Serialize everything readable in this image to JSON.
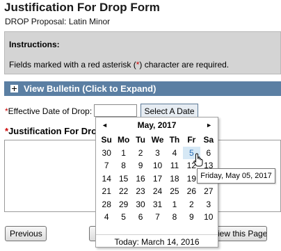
{
  "page": {
    "title": "Justification For Drop Form",
    "subtitle": "DROP Proposal: Latin Minor"
  },
  "instructions": {
    "heading": "Instructions:",
    "text_before": "Fields marked with a red asterisk (",
    "asterisk": "*",
    "text_after": ") character are required."
  },
  "bulletin": {
    "label": "View Bulletin (Click to Expand)",
    "icon": "plus-box-icon"
  },
  "effective_date": {
    "asterisk": "*",
    "label": "Effective Date of Drop:",
    "value": "",
    "button_label": "Select A Date"
  },
  "justification": {
    "asterisk": "*",
    "label": "Justification For Dro",
    "value": ""
  },
  "buttons": {
    "previous": "Previous",
    "middle": "F",
    "view_page": "view this Page"
  },
  "calendar": {
    "prev_glyph": "◄",
    "next_glyph": "►",
    "month_label": "May, 2017",
    "weekdays": [
      "Su",
      "Mo",
      "Tu",
      "We",
      "Th",
      "Fr",
      "Sa"
    ],
    "days": [
      {
        "d": "30",
        "other": true
      },
      {
        "d": "1"
      },
      {
        "d": "2"
      },
      {
        "d": "3"
      },
      {
        "d": "4"
      },
      {
        "d": "5",
        "selected": true
      },
      {
        "d": "6"
      },
      {
        "d": "7"
      },
      {
        "d": "8"
      },
      {
        "d": "9"
      },
      {
        "d": "10"
      },
      {
        "d": "11"
      },
      {
        "d": "12"
      },
      {
        "d": "13"
      },
      {
        "d": "14"
      },
      {
        "d": "15"
      },
      {
        "d": "16"
      },
      {
        "d": "17"
      },
      {
        "d": "18"
      },
      {
        "d": "19"
      },
      {
        "d": "20"
      },
      {
        "d": "21"
      },
      {
        "d": "22"
      },
      {
        "d": "23"
      },
      {
        "d": "24"
      },
      {
        "d": "25"
      },
      {
        "d": "26"
      },
      {
        "d": "27"
      },
      {
        "d": "28"
      },
      {
        "d": "29"
      },
      {
        "d": "30"
      },
      {
        "d": "31"
      },
      {
        "d": "1",
        "other": true
      },
      {
        "d": "2",
        "other": true
      },
      {
        "d": "3",
        "other": true
      },
      {
        "d": "4",
        "other": true
      },
      {
        "d": "5",
        "other": true
      },
      {
        "d": "6",
        "other": true
      },
      {
        "d": "7",
        "other": true
      },
      {
        "d": "8",
        "other": true
      },
      {
        "d": "9",
        "other": true
      },
      {
        "d": "10",
        "other": true
      }
    ],
    "today_label": "Today: March 14, 2016"
  },
  "tooltip": {
    "text": "Friday, May 05, 2017"
  },
  "colors": {
    "bulletin_bar": "#5b7fa3",
    "instructions_bg": "#d4d4d4",
    "required": "#cc0000",
    "selected_day": "#d6e8f5"
  }
}
